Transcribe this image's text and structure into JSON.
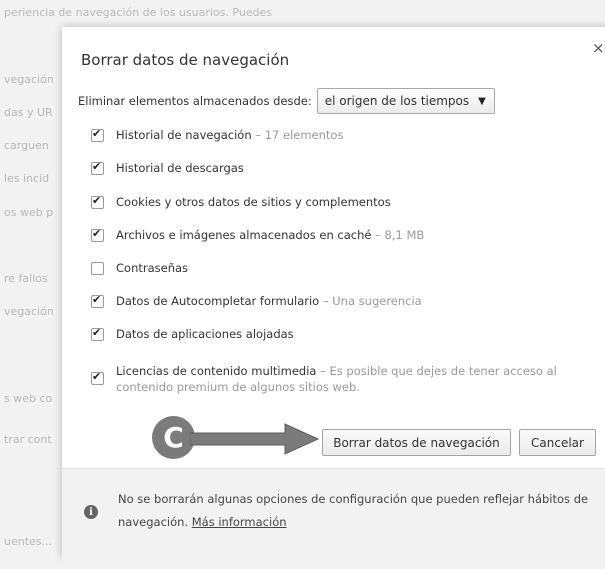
{
  "background": {
    "lines": [
      "periencia de navegación de los usuarios. Puedes",
      "vegación",
      "das y UR",
      "carguen",
      "les incid",
      "os web p",
      "re fallos",
      "vegación",
      "s web co",
      "trar cont",
      "uentes..."
    ]
  },
  "dialog": {
    "title": "Borrar datos de navegación",
    "close_glyph": "×",
    "range_label": "Eliminar elementos almacenados desde:",
    "range_value": "el origen de los tiempos",
    "options": [
      {
        "label": "Historial de navegación",
        "detail": " – 17 elementos",
        "checked": true
      },
      {
        "label": "Historial de descargas",
        "detail": "",
        "checked": true
      },
      {
        "label": "Cookies y otros datos de sitios y complementos",
        "detail": "",
        "checked": true
      },
      {
        "label": "Archivos e imágenes almacenados en caché",
        "detail": " – 8,1 MB",
        "checked": true
      },
      {
        "label": "Contraseñas",
        "detail": "",
        "checked": false
      },
      {
        "label": "Datos de Autocompletar formulario",
        "detail": " – Una sugerencia",
        "checked": true
      },
      {
        "label": "Datos de aplicaciones alojadas",
        "detail": "",
        "checked": true
      },
      {
        "label": "Licencias de contenido multimedia",
        "detail": " – Es posible que dejes de tener acceso al contenido premium de algunos sitios web.",
        "checked": true
      }
    ],
    "clear_button": "Borrar datos de navegación",
    "cancel_button": "Cancelar",
    "footer_text": "No se borrarán algunas opciones de configuración que pueden reflejar hábitos de navegación.",
    "footer_link": "Más información",
    "info_icon": "info-icon"
  },
  "callout": {
    "letter": "C",
    "color": "#7b7b7b"
  }
}
